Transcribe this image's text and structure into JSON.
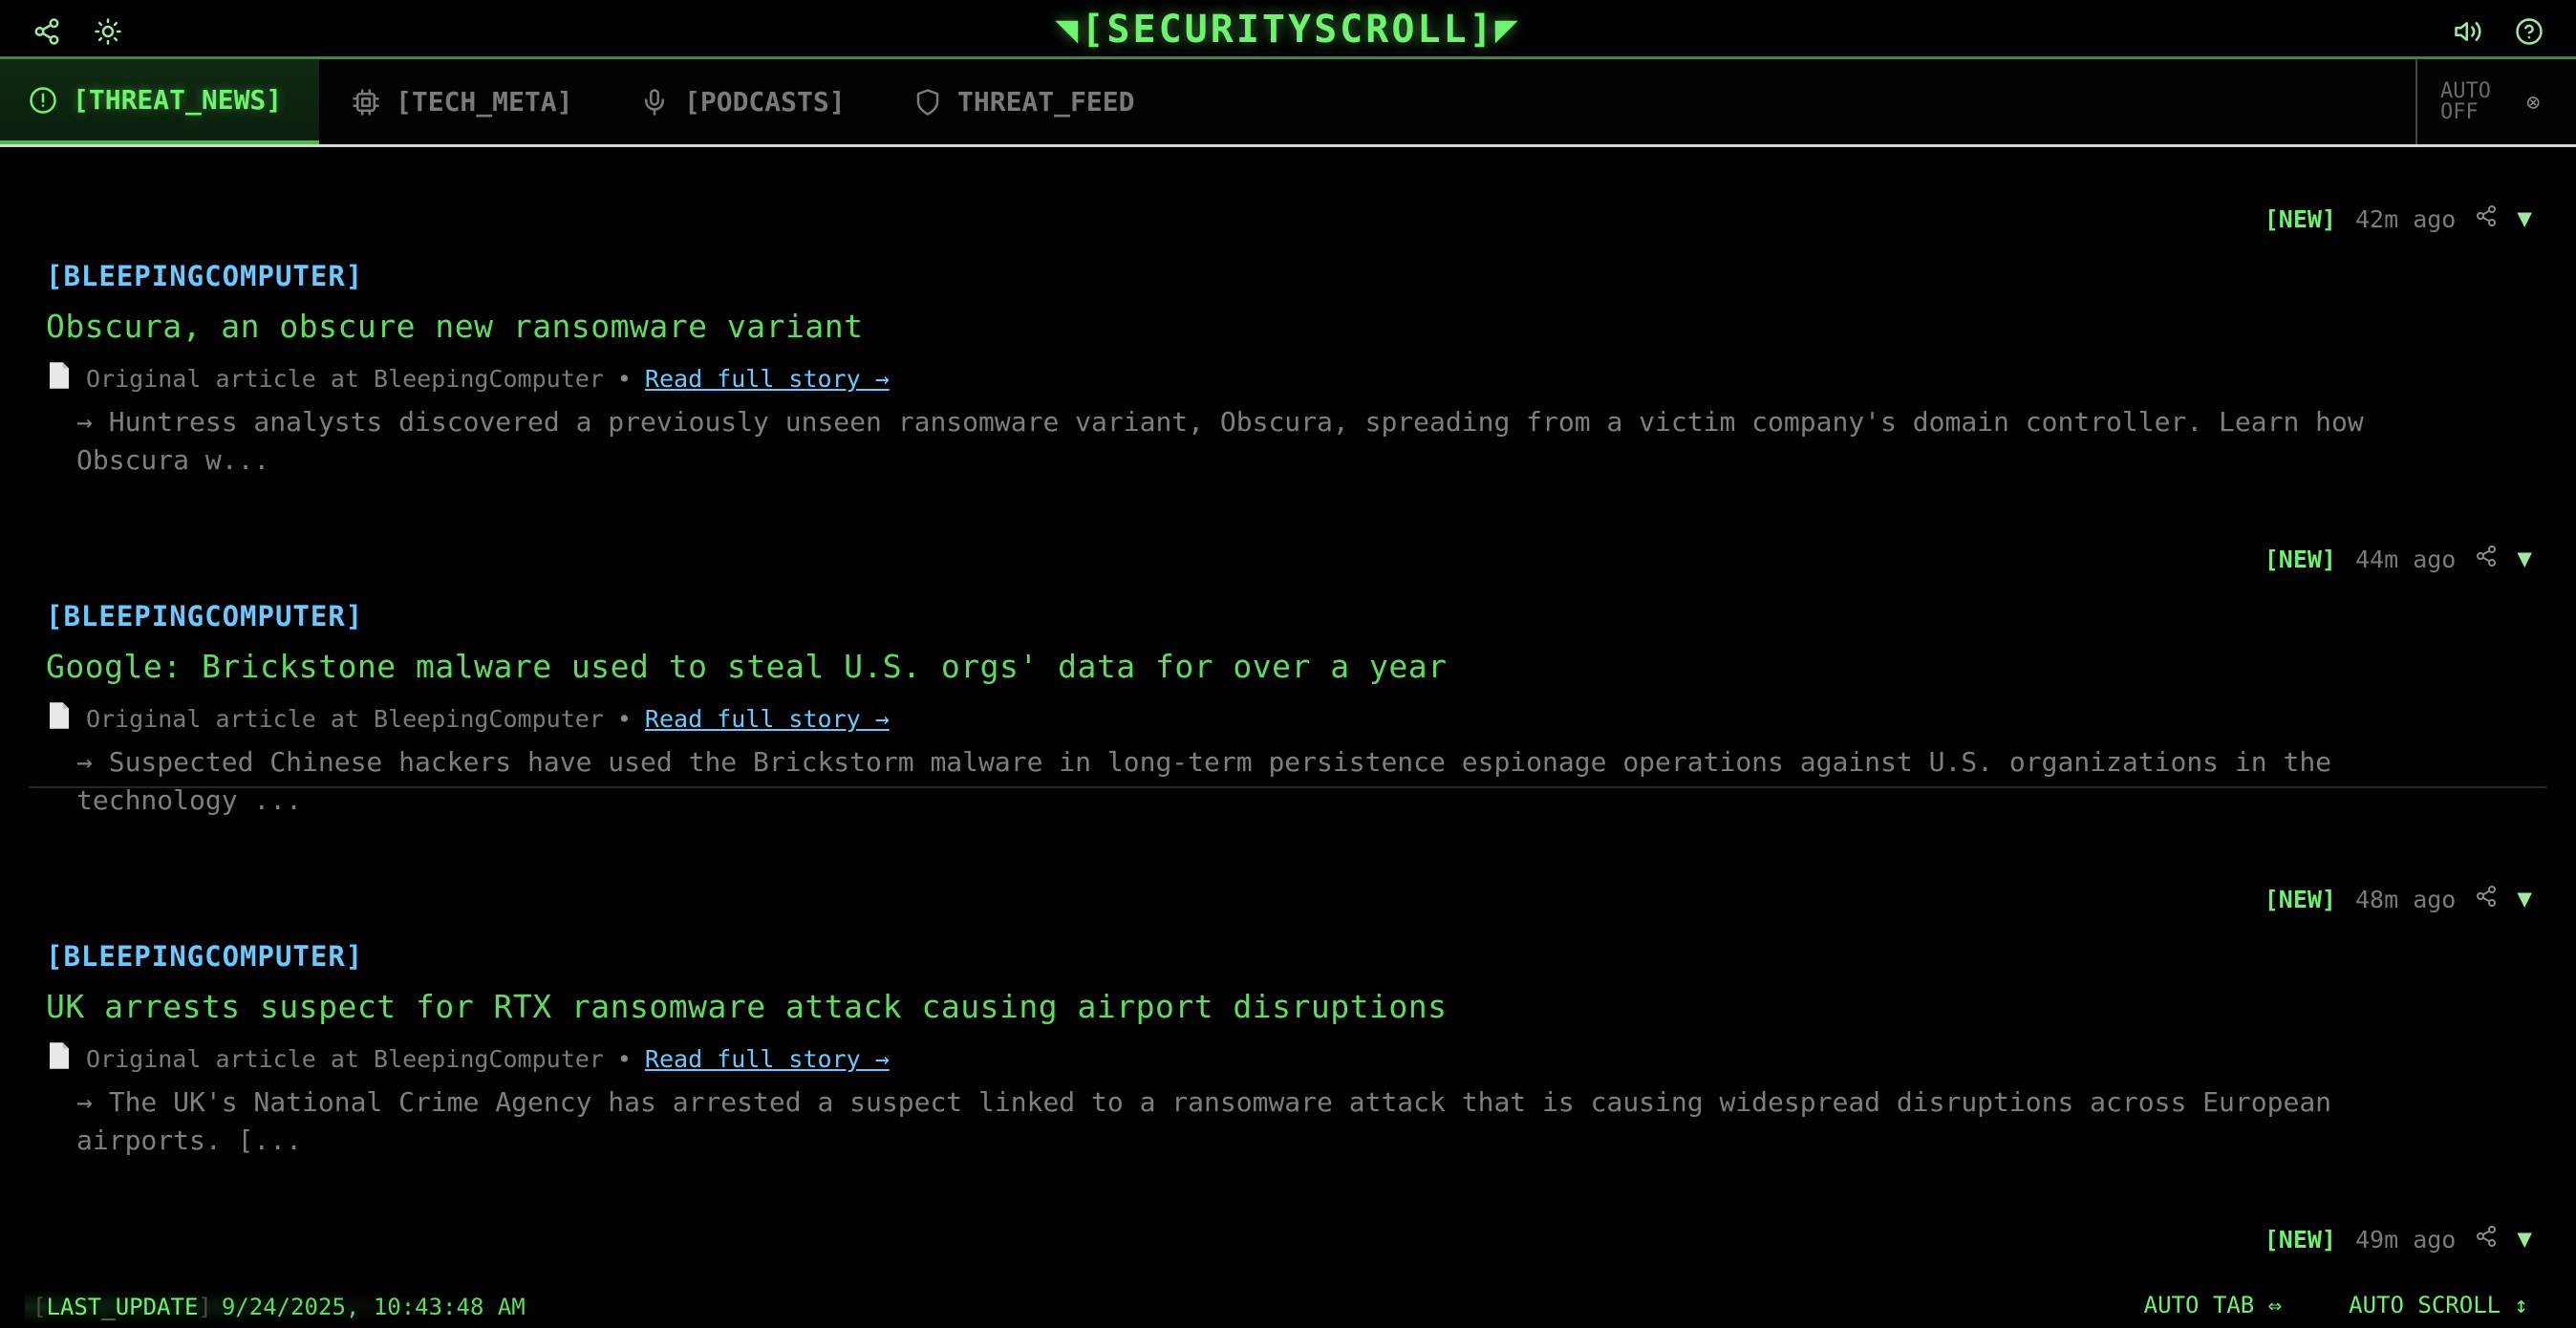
{
  "app": {
    "title": "◥[SECURITYSCROLL]◤"
  },
  "header": {
    "left_icons": [
      "share-icon",
      "sun-icon"
    ],
    "right_icons": [
      "volume-icon",
      "help-icon"
    ]
  },
  "tabs": [
    {
      "label": "[THREAT_NEWS]",
      "icon": "alert-circle-icon",
      "active": true
    },
    {
      "label": "[TECH_META]",
      "icon": "cpu-icon",
      "active": false
    },
    {
      "label": "[PODCASTS]",
      "icon": "mic-icon",
      "active": false
    },
    {
      "label": "THREAT_FEED",
      "icon": "shield-icon",
      "active": false
    }
  ],
  "auto_toggle": {
    "label": "AUTO OFF",
    "close": "⊗"
  },
  "articles": [
    {
      "badge": "[NEW]",
      "time": "42m ago",
      "source": "[BLEEPINGCOMPUTER]",
      "title": "Obscura, an obscure new ransomware variant",
      "origin": "Original article at BleepingComputer",
      "link": "Read full story →",
      "summary": "→ Huntress analysts discovered a previously unseen ransomware variant, Obscura, spreading from a victim company's domain controller. Learn how Obscura w..."
    },
    {
      "badge": "[NEW]",
      "time": "44m ago",
      "source": "[BLEEPINGCOMPUTER]",
      "title": "Google: Brickstone malware used to steal U.S. orgs' data for over a year",
      "origin": "Original article at BleepingComputer",
      "link": "Read full story →",
      "summary": "→ Suspected Chinese hackers have used the Brickstorm malware in long-term persistence espionage operations against U.S. organizations in the technology ..."
    },
    {
      "badge": "[NEW]",
      "time": "48m ago",
      "source": "[BLEEPINGCOMPUTER]",
      "title": "UK arrests suspect for RTX ransomware attack causing airport disruptions",
      "origin": "Original article at BleepingComputer",
      "link": "Read full story →",
      "summary": "→ The UK's National Crime Agency has arrested a suspect linked to a ransomware attack that is causing widespread disruptions across European airports. [..."
    },
    {
      "badge": "[NEW]",
      "time": "49m ago"
    }
  ],
  "footer": {
    "last_update_label": "LAST_UPDATE",
    "last_update_value": "9/24/2025, 10:43:48 AM",
    "auto_tab": "AUTO TAB ⇔",
    "auto_scroll": "AUTO SCROLL ↕"
  }
}
